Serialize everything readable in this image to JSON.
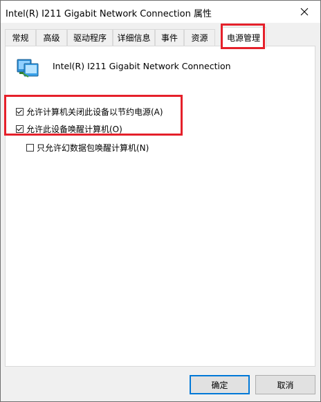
{
  "window": {
    "title": "Intel(R) I211 Gigabit Network Connection 属性"
  },
  "tabs": [
    {
      "label": "常规"
    },
    {
      "label": "高级"
    },
    {
      "label": "驱动程序"
    },
    {
      "label": "详细信息"
    },
    {
      "label": "事件"
    },
    {
      "label": "资源"
    },
    {
      "label": "电源管理",
      "active": true
    }
  ],
  "device": {
    "name": "Intel(R) I211 Gigabit Network Connection"
  },
  "options": [
    {
      "label": "允许计算机关闭此设备以节约电源(A)",
      "checked": true
    },
    {
      "label": "允许此设备唤醒计算机(O)",
      "checked": true
    },
    {
      "label": "只允许幻数据包唤醒计算机(N)",
      "checked": false
    }
  ],
  "buttons": {
    "ok": "确定",
    "cancel": "取消"
  },
  "colors": {
    "highlight": "#e5202a",
    "default_button_border": "#0078d7"
  },
  "icons": {
    "close": "close-icon",
    "device": "network-adapter-icon"
  }
}
